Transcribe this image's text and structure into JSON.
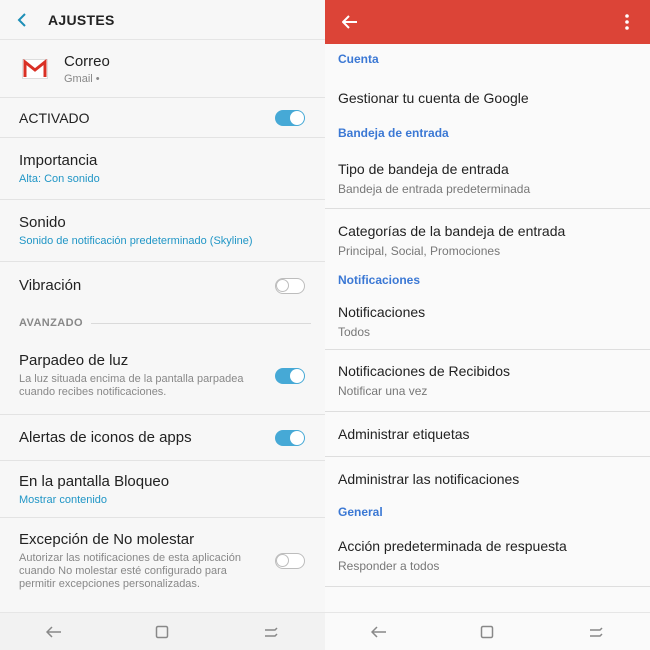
{
  "left": {
    "header": {
      "title": "AJUSTES"
    },
    "app": {
      "name": "Correo",
      "sub": "Gmail •"
    },
    "activado": {
      "label": "ACTIVADO",
      "on": true
    },
    "importancia": {
      "label": "Importancia",
      "value": "Alta: Con sonido"
    },
    "sonido": {
      "label": "Sonido",
      "value": "Sonido de notificación predeterminado (Skyline)"
    },
    "vibracion": {
      "label": "Vibración",
      "on": false
    },
    "avanzado": {
      "label": "AVANZADO"
    },
    "parpadeo": {
      "label": "Parpadeo de luz",
      "desc": "La luz situada encima de la pantalla parpadea cuando recibes notificaciones.",
      "on": true
    },
    "alertas": {
      "label": "Alertas de iconos de apps",
      "on": true
    },
    "bloqueo": {
      "label": "En la pantalla Bloqueo",
      "value": "Mostrar contenido"
    },
    "excepcion": {
      "label": "Excepción de No molestar",
      "desc": "Autorizar las notificaciones de esta aplicación cuando No molestar esté configurado para permitir excepciones personalizadas.",
      "on": false
    }
  },
  "right": {
    "sections": {
      "cuenta": "Cuenta",
      "bandeja": "Bandeja de entrada",
      "notificaciones": "Notificaciones",
      "general": "General"
    },
    "items": {
      "gestionar": {
        "label": "Gestionar tu cuenta de Google"
      },
      "tipo": {
        "label": "Tipo de bandeja de entrada",
        "sub": "Bandeja de entrada predeterminada"
      },
      "categorias": {
        "label": "Categorías de la bandeja de entrada",
        "sub": "Principal, Social, Promociones"
      },
      "notif": {
        "label": "Notificaciones",
        "sub": "Todos"
      },
      "recibidos": {
        "label": "Notificaciones de Recibidos",
        "sub": "Notificar una vez"
      },
      "etiquetas": {
        "label": "Administrar etiquetas"
      },
      "adminnotif": {
        "label": "Administrar las notificaciones"
      },
      "accion": {
        "label": "Acción predeterminada de respuesta",
        "sub": "Responder a todos"
      }
    }
  },
  "colors": {
    "accent_blue": "#46a9d6",
    "link_blue": "#2196c6",
    "header_red": "#dc4437",
    "section_blue": "#3b78d4"
  },
  "icons": [
    "back-chevron-icon",
    "gmail-icon",
    "back-arrow-icon",
    "more-vert-icon",
    "nav-back-icon",
    "nav-home-icon",
    "nav-recents-icon"
  ]
}
